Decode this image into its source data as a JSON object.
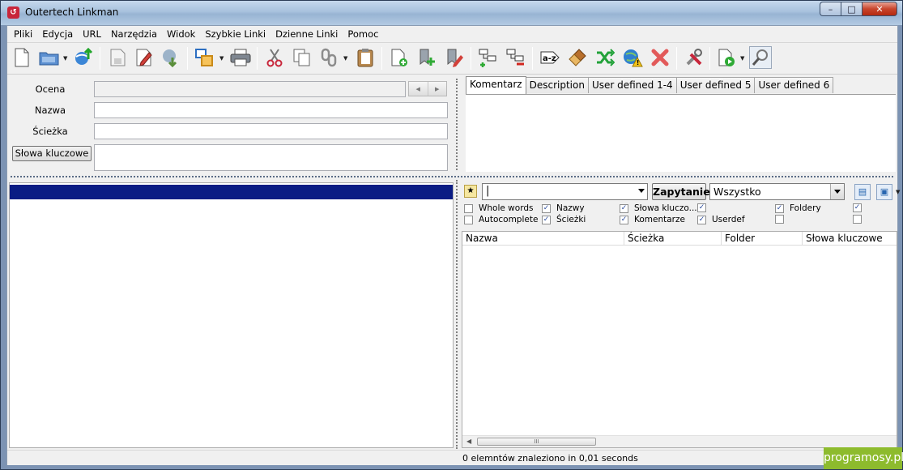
{
  "window": {
    "title": "Outertech Linkman",
    "minimize": "–",
    "maximize": "□",
    "close": "✕",
    "app_icon": "↺"
  },
  "menu": [
    "Pliki",
    "Edycja",
    "URL",
    "Narzędzia",
    "Widok",
    "Szybkie Linki",
    "Dzienne Linki",
    "Pomoc"
  ],
  "toolbar_icons": [
    "new-document-icon",
    "open-folder-icon",
    "import-icon",
    "save-icon",
    "edit-icon",
    "export-icon",
    "tree-view-icon",
    "print-icon",
    "cut-icon",
    "copy-icon",
    "link-icon",
    "paste-icon",
    "add-document-icon",
    "add-bookmark-icon",
    "edit-bookmark-icon",
    "add-folder-icon",
    "delete-folder-icon",
    "sort-az-icon",
    "clean-icon",
    "shuffle-icon",
    "check-links-icon",
    "delete-icon",
    "tools-icon",
    "play-document-icon",
    "search-icon"
  ],
  "fields": {
    "rating_label": "Ocena",
    "name_label": "Nazwa",
    "path_label": "Ścieżka",
    "keywords_button": "Słowa kluczowe",
    "name_value": "",
    "path_value": ""
  },
  "tabs": [
    "Komentarz",
    "Description",
    "User defined 1-4",
    "User defined 5",
    "User defined 6"
  ],
  "search": {
    "query_value": "",
    "query_button": "Zapytanie",
    "scope": "Wszystko"
  },
  "options": {
    "whole_words": {
      "label": "Whole words",
      "checked": false
    },
    "autocomplete": {
      "label": "Autocomplete",
      "checked": false
    },
    "names": {
      "label": "Nazwy",
      "checked": true
    },
    "paths": {
      "label": "Ścieżki",
      "checked": true
    },
    "keywords": {
      "label": "Słowa kluczo...",
      "checked": true
    },
    "comments": {
      "label": "Komentarze",
      "checked": true
    },
    "userdef": {
      "label": "Userdef",
      "checked": true
    },
    "folders": {
      "label": "Foldery",
      "checked": true
    }
  },
  "results": {
    "columns": [
      "Nazwa",
      "Ścieżka",
      "Folder",
      "Słowa kluczowe"
    ],
    "rows": [],
    "scroll_grip": "III"
  },
  "status": "0 elemntów znaleziono in 0,01 seconds",
  "watermark": "programosy.pl"
}
